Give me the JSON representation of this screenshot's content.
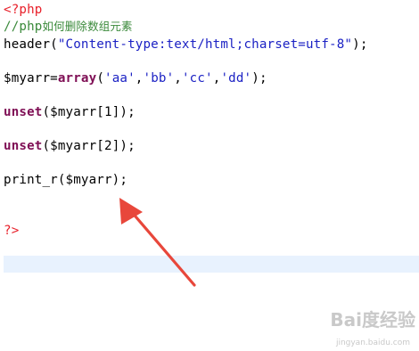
{
  "editor": {
    "lines": [
      {
        "id": "php-open",
        "tokens": [
          {
            "text": "<?php",
            "color": "#e8202a"
          }
        ]
      },
      {
        "id": "comment",
        "tokens": [
          {
            "text": "//php",
            "color": "#3b8a3b"
          },
          {
            "text": "如何删除数组元素",
            "color": "#3b8a3b",
            "cjk": true
          }
        ]
      },
      {
        "id": "header-call",
        "tokens": [
          {
            "text": "header(",
            "color": "#000000"
          },
          {
            "text": "\"Content-type:text/html;charset=utf-8\"",
            "color": "#1c22c4"
          },
          {
            "text": ");",
            "color": "#000000"
          }
        ]
      },
      {
        "id": "blank-1",
        "tokens": []
      },
      {
        "id": "array-assign",
        "tokens": [
          {
            "text": "$myarr=",
            "color": "#000000"
          },
          {
            "text": "array",
            "color": "#7f0f55",
            "bold": true
          },
          {
            "text": "(",
            "color": "#000000"
          },
          {
            "text": "'aa'",
            "color": "#1c22c4"
          },
          {
            "text": ",",
            "color": "#000000"
          },
          {
            "text": "'bb'",
            "color": "#1c22c4"
          },
          {
            "text": ",",
            "color": "#000000"
          },
          {
            "text": "'cc'",
            "color": "#1c22c4"
          },
          {
            "text": ",",
            "color": "#000000"
          },
          {
            "text": "'dd'",
            "color": "#1c22c4"
          },
          {
            "text": ");",
            "color": "#000000"
          }
        ]
      },
      {
        "id": "blank-2",
        "tokens": []
      },
      {
        "id": "unset-1",
        "tokens": [
          {
            "text": "unset",
            "color": "#7f0f55",
            "bold": true
          },
          {
            "text": "($myarr[1]);",
            "color": "#000000"
          }
        ]
      },
      {
        "id": "blank-3",
        "tokens": []
      },
      {
        "id": "unset-2",
        "tokens": [
          {
            "text": "unset",
            "color": "#7f0f55",
            "bold": true
          },
          {
            "text": "($myarr[2]);",
            "color": "#000000"
          }
        ]
      },
      {
        "id": "blank-4",
        "tokens": []
      },
      {
        "id": "print-r",
        "tokens": [
          {
            "text": "print_r($myarr);",
            "color": "#000000"
          }
        ]
      },
      {
        "id": "blank-5",
        "tokens": []
      },
      {
        "id": "blank-6",
        "tokens": []
      },
      {
        "id": "php-close",
        "tokens": [
          {
            "text": "?>",
            "color": "#e8202a"
          }
        ]
      }
    ],
    "current_line_color": "#e8f2fe"
  },
  "annotation": {
    "arrow_color": "#e8473b"
  },
  "watermark": {
    "title": "Bai度经验",
    "url": "jingyan.baidu.com"
  }
}
